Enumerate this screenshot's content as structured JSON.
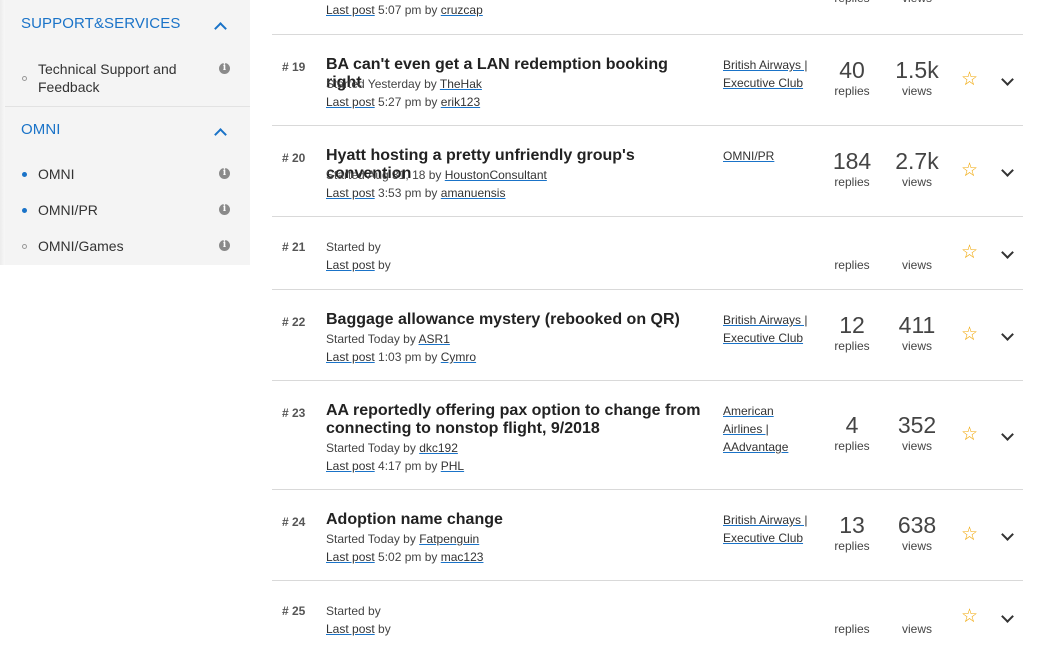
{
  "sidebar": {
    "sections": [
      {
        "heading": "SUPPORT&SERVICES",
        "items": [
          {
            "label": "Technical Support and Feedback",
            "bullet": "open"
          }
        ]
      },
      {
        "heading": "OMNI",
        "items": [
          {
            "label": "OMNI",
            "bullet": "filled"
          },
          {
            "label": "OMNI/PR",
            "bullet": "filled"
          },
          {
            "label": "OMNI/Games",
            "bullet": "open"
          }
        ]
      }
    ]
  },
  "top_partial": {
    "last_post_label": "Last post",
    "time": "5:07 pm by",
    "user": "cruzcap",
    "replies_label": "replies",
    "views_label": "views"
  },
  "topics": [
    {
      "num": "# 19",
      "title": "BA can't even get a LAN redemption booking right",
      "started_prefix": "Started Yesterday by",
      "starter": "TheHak",
      "last_post_label": "Last post",
      "last_post_time": "5:27 pm by",
      "last_user": "erik123",
      "forum": "British Airways | Executive Club",
      "replies": "40",
      "replies_label": "replies",
      "views": "1.5k",
      "views_label": "views"
    },
    {
      "num": "# 20",
      "title": "Hyatt hosting a pretty unfriendly group's convention",
      "started_prefix": "Started Aug 31, 18 by",
      "starter": "HoustonConsultant",
      "last_post_label": "Last post",
      "last_post_time": "3:53 pm by",
      "last_user": "amanuensis",
      "forum": "OMNI/PR",
      "replies": "184",
      "replies_label": "replies",
      "views": "2.7k",
      "views_label": "views"
    },
    {
      "num": "# 21",
      "title": "",
      "started_prefix": "Started by",
      "starter": "",
      "last_post_label": "Last post",
      "last_post_time": "by",
      "last_user": "",
      "forum": "",
      "replies": "",
      "replies_label": "replies",
      "views": "",
      "views_label": "views"
    },
    {
      "num": "# 22",
      "title": "Baggage allowance mystery (rebooked on QR)",
      "started_prefix": "Started Today by",
      "starter": "ASR1",
      "last_post_label": "Last post",
      "last_post_time": "1:03 pm by",
      "last_user": "Cymro",
      "forum": "British Airways | Executive Club",
      "replies": "12",
      "replies_label": "replies",
      "views": "411",
      "views_label": "views"
    },
    {
      "num": "# 23",
      "title": "AA reportedly offering pax option to change from connecting to nonstop flight, 9/2018",
      "started_prefix": "Started Today by",
      "starter": "dkc192",
      "last_post_label": "Last post",
      "last_post_time": "4:17 pm by",
      "last_user": "PHL",
      "forum": "American Airlines | AAdvantage",
      "replies": "4",
      "replies_label": "replies",
      "views": "352",
      "views_label": "views"
    },
    {
      "num": "# 24",
      "title": "Adoption name change",
      "started_prefix": "Started Today by",
      "starter": "Fatpenguin",
      "last_post_label": "Last post",
      "last_post_time": "5:02 pm by",
      "last_user": "mac123",
      "forum": "British Airways | Executive Club",
      "replies": "13",
      "replies_label": "replies",
      "views": "638",
      "views_label": "views"
    },
    {
      "num": "# 25",
      "title": "",
      "started_prefix": "Started by",
      "starter": "",
      "last_post_label": "Last post",
      "last_post_time": "by",
      "last_user": "",
      "forum": "",
      "replies": "",
      "replies_label": "replies",
      "views": "",
      "views_label": "views"
    }
  ],
  "icons": {
    "star": "star-outline-icon",
    "chevron": "chevron-down-icon",
    "info": "info-icon"
  },
  "colors": {
    "accent": "#1a73c8",
    "star": "#f0a500"
  }
}
